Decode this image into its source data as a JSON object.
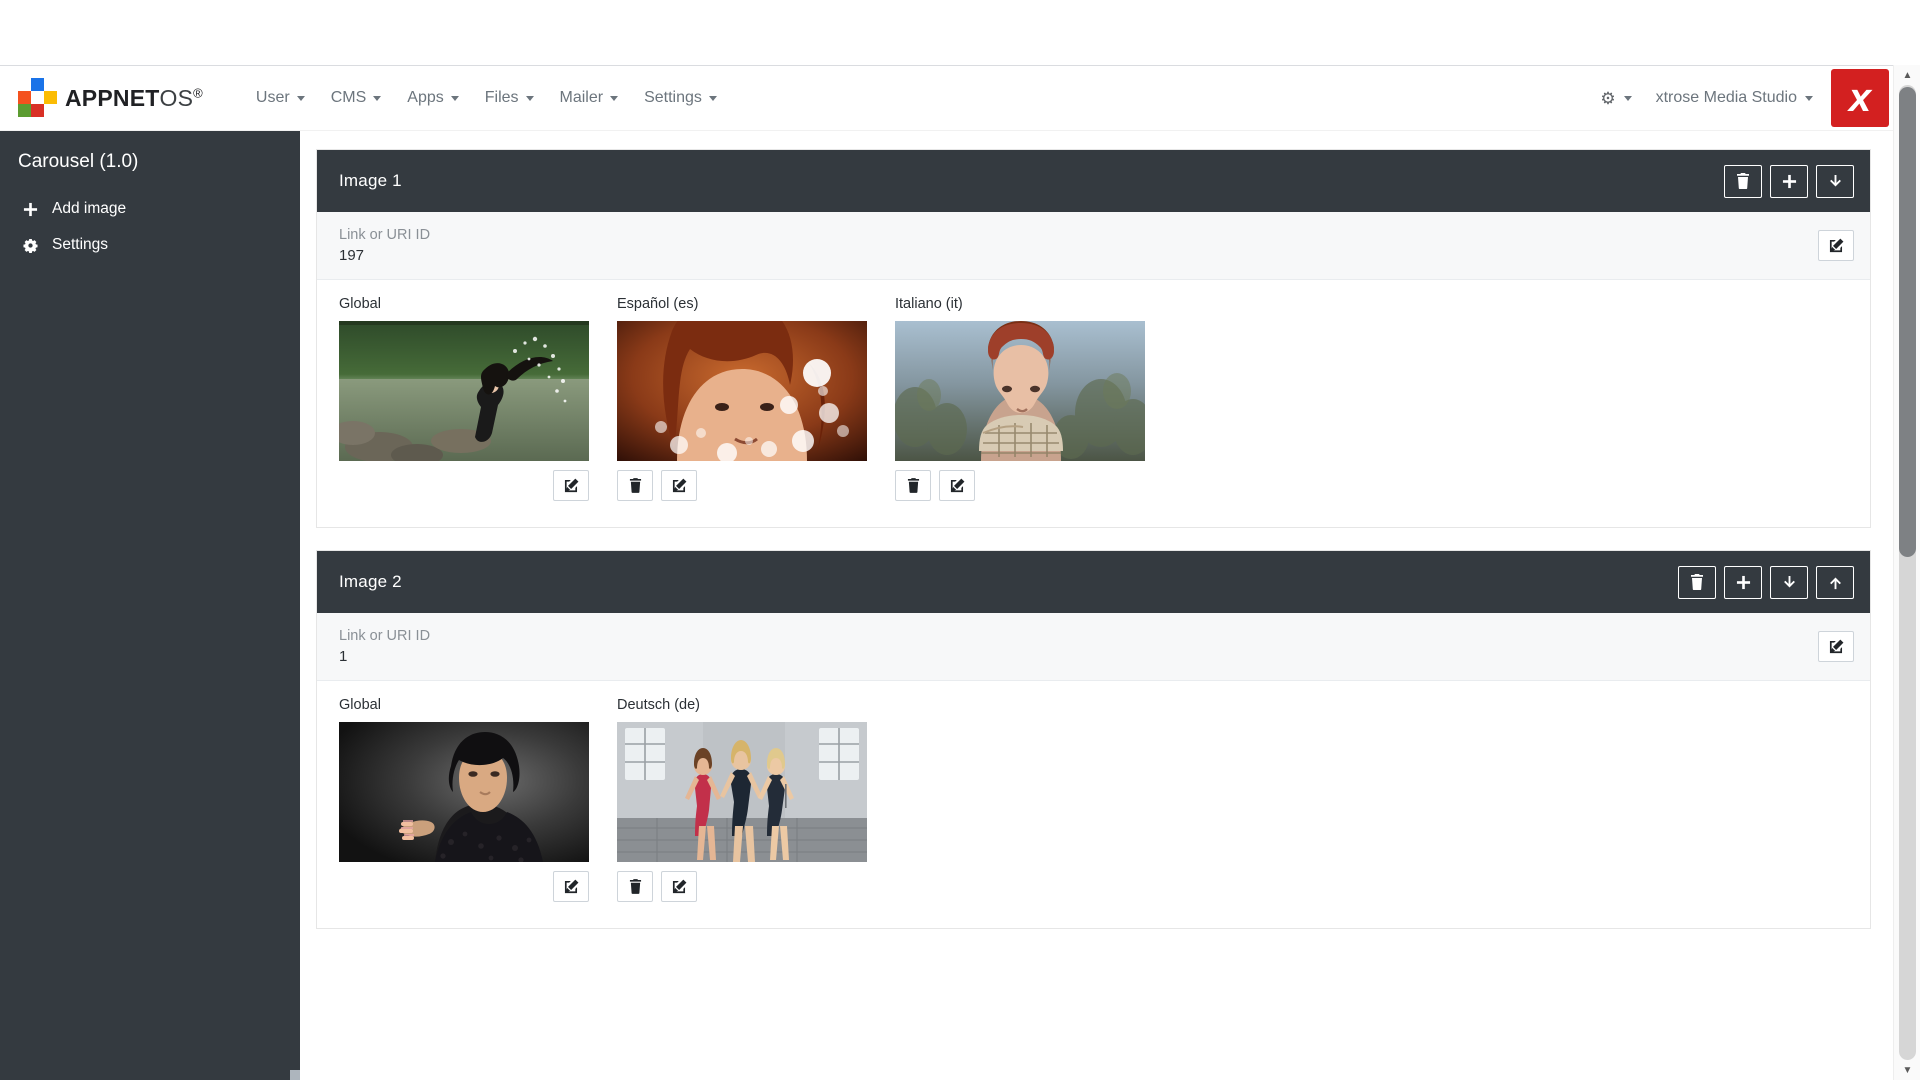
{
  "navbar": {
    "brand": {
      "bold": "APPNET",
      "thin": "OS",
      "reg": "®"
    },
    "items": [
      {
        "label": "User"
      },
      {
        "label": "CMS"
      },
      {
        "label": "Apps"
      },
      {
        "label": "Files"
      },
      {
        "label": "Mailer"
      },
      {
        "label": "Settings"
      }
    ],
    "gear_icon": "gear-icon",
    "account": "xtrose Media Studio",
    "x_logo": "x"
  },
  "sidebar": {
    "title": "Carousel (1.0)",
    "items": [
      {
        "label": "Add image",
        "icon": "plus-icon"
      },
      {
        "label": "Settings",
        "icon": "gear-icon"
      }
    ]
  },
  "main": {
    "panels": [
      {
        "title": "Image 1",
        "head_buttons": [
          {
            "name": "delete-image-button",
            "icon": "trash-icon"
          },
          {
            "name": "add-image-button",
            "icon": "plus-icon"
          },
          {
            "name": "move-down-button",
            "icon": "arrow-down-icon"
          }
        ],
        "link": {
          "label": "Link or URI ID",
          "value": "197"
        },
        "slides": [
          {
            "label": "Global",
            "actions": [
              "edit"
            ],
            "align": "right",
            "img": "lake-woman"
          },
          {
            "label": "Español (es)",
            "actions": [
              "trash",
              "edit"
            ],
            "align": "left",
            "img": "bokeh-portrait"
          },
          {
            "label": "Italiano (it)",
            "actions": [
              "trash",
              "edit"
            ],
            "align": "left",
            "img": "redhead-scarf"
          }
        ]
      },
      {
        "title": "Image 2",
        "head_buttons": [
          {
            "name": "delete-image-button",
            "icon": "trash-icon"
          },
          {
            "name": "add-image-button",
            "icon": "plus-icon"
          },
          {
            "name": "move-down-button",
            "icon": "arrow-down-icon"
          },
          {
            "name": "move-up-button",
            "icon": "arrow-up-icon"
          }
        ],
        "link": {
          "label": "Link or URI ID",
          "value": "1"
        },
        "slides": [
          {
            "label": "Global",
            "actions": [
              "edit"
            ],
            "align": "right",
            "img": "dark-portrait"
          },
          {
            "label": "Deutsch (de)",
            "actions": [
              "trash",
              "edit"
            ],
            "align": "left",
            "img": "three-dancers"
          }
        ]
      }
    ]
  },
  "colors": {
    "sidebar_bg": "#343a40",
    "panel_head_bg": "#343a40",
    "accent_red": "#d32020",
    "muted_text": "#6c757d",
    "page_bg": "#ffffff"
  },
  "scrollbar": {
    "up": "▲",
    "down": "▼"
  }
}
